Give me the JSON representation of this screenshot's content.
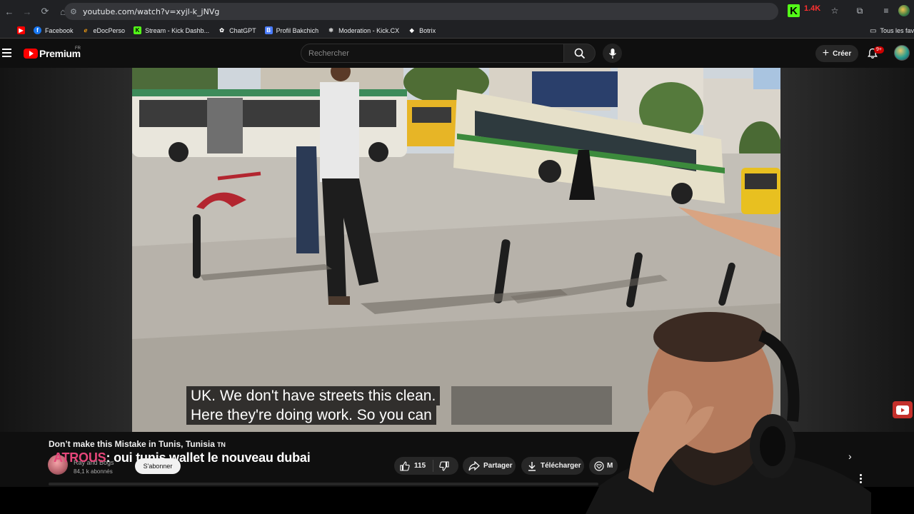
{
  "browser": {
    "url": "youtube.com/watch?v=xyjl-k_jNVg",
    "extension_badge": "1.4K"
  },
  "bookmarks": {
    "items": [
      {
        "label": "",
        "icon": "youtube-icon",
        "color": "#ff0000"
      },
      {
        "label": "Facebook",
        "icon": "facebook-icon",
        "color": "#1877f2"
      },
      {
        "label": "eDocPerso",
        "icon": "edocperso-icon",
        "color": "#f39c12"
      },
      {
        "label": "Stream - Kick Dashb...",
        "icon": "kick-icon",
        "color": "#53fc18"
      },
      {
        "label": "ChatGPT",
        "icon": "chatgpt-icon",
        "color": "#ffffff"
      },
      {
        "label": "Profil Bakchich",
        "icon": "bakchich-icon",
        "color": "#4a7cff"
      },
      {
        "label": "Moderation - Kick.CX",
        "icon": "moderation-icon",
        "color": "#cccccc"
      },
      {
        "label": "Botrix",
        "icon": "botrix-icon",
        "color": "#ffffff"
      }
    ],
    "all_bookmarks": "Tous les fav"
  },
  "youtube": {
    "logo": "Premium",
    "region": "FR",
    "search_placeholder": "Rechercher",
    "create_label": "Créer",
    "notif_count": "9+"
  },
  "video": {
    "subtitle_line1": "UK. We don't have streets this clean.",
    "subtitle_line2": "Here they're doing work. So you can",
    "title": "Don’t make this Mistake in Tunis, Tunisia",
    "title_flag": "TN",
    "overlay_prefix": "ATROUS",
    "overlay_text": ": oui tunis wallet le nouveau dubai",
    "channel_name": "Ray and Bogs",
    "channel_subs": "84,1 k abonnés",
    "subscribe_label": "S'abonner",
    "likes": "115",
    "share_label": "Partager",
    "download_label": "Télécharger",
    "thanks_label": "M"
  }
}
